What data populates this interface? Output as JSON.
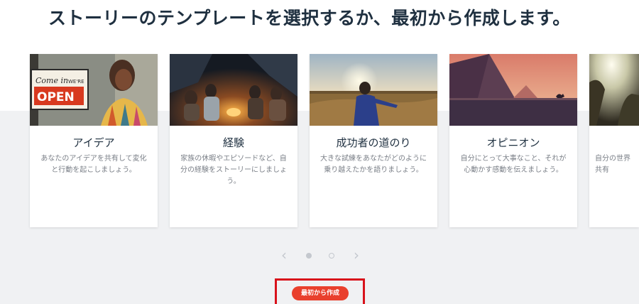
{
  "page": {
    "title": "ストーリーのテンプレートを選択するか、最初から作成します。"
  },
  "cards": [
    {
      "title": "アイデア",
      "description": "あなたのアイデアを共有して変化と行動を起こしましょう。",
      "sign": {
        "line1": "Come in",
        "line2": "WE'RE",
        "line3": "OPEN"
      }
    },
    {
      "title": "経験",
      "description": "家族の休暇やエピソードなど、自分の経験をストーリーにしましょう。"
    },
    {
      "title": "成功者の道のり",
      "description": "大きな試練をあなたがどのように乗り越えたかを語りましょう。"
    },
    {
      "title": "オピニオン",
      "description": "自分にとって大事なこと、それが心動かす感動を伝えましょう。"
    },
    {
      "title": "",
      "description": "自分の世界\n共有"
    }
  ],
  "carousel": {
    "prev_icon": "‹",
    "next_icon": "›",
    "page_count": 2,
    "current_page": 1
  },
  "actions": {
    "start_from_scratch": "最初から作成"
  },
  "colors": {
    "title": "#1f3040",
    "accent": "#e9402d",
    "highlight": "#d8121b",
    "background": "#f0f1f3"
  }
}
